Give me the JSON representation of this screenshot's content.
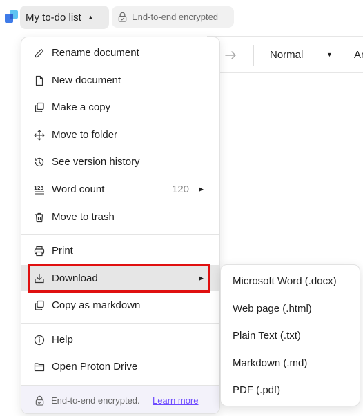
{
  "header": {
    "doc_title": "My to-do list",
    "encryption_badge": "End-to-end encrypted"
  },
  "toolbar": {
    "style_value": "Normal",
    "font_value": "Ar"
  },
  "menu": {
    "items": [
      {
        "label": "Rename document",
        "icon": "pencil-icon"
      },
      {
        "label": "New document",
        "icon": "file-icon"
      },
      {
        "label": "Make a copy",
        "icon": "copy-icon"
      },
      {
        "label": "Move to folder",
        "icon": "move-icon"
      },
      {
        "label": "See version history",
        "icon": "history-icon"
      },
      {
        "label": "Word count",
        "icon": "word-count-icon",
        "count": "120"
      },
      {
        "label": "Move to trash",
        "icon": "trash-icon"
      },
      {
        "label": "Print",
        "icon": "printer-icon"
      },
      {
        "label": "Download",
        "icon": "download-icon"
      },
      {
        "label": "Copy as markdown",
        "icon": "copy-icon"
      },
      {
        "label": "Help",
        "icon": "info-icon"
      },
      {
        "label": "Open Proton Drive",
        "icon": "folder-icon"
      }
    ],
    "footer": {
      "text": "End-to-end encrypted.",
      "link": "Learn more"
    }
  },
  "download_submenu": {
    "items": [
      "Microsoft Word (.docx)",
      "Web page (.html)",
      "Plain Text (.txt)",
      "Markdown (.md)",
      "PDF (.pdf)"
    ]
  },
  "colors": {
    "accent": "#6d4aff",
    "highlight": "#e01010",
    "active_row": "#e6e6e6"
  }
}
